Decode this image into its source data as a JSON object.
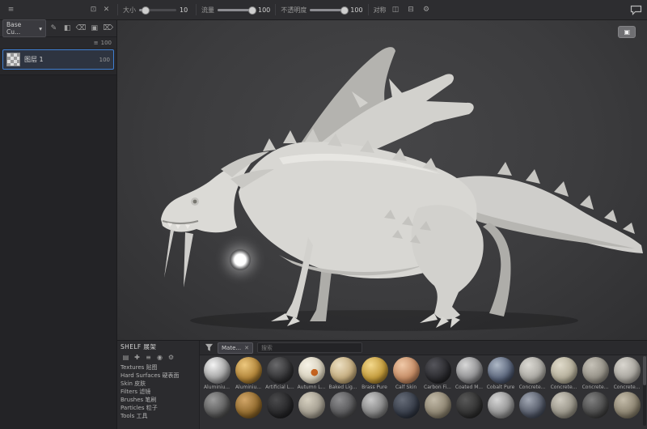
{
  "icons": {
    "menu": "≡",
    "float": "⊡",
    "close": "✕",
    "chevron_down": "▾",
    "pencil": "✎",
    "fill": "◧",
    "eraser": "⌫",
    "stamp": "▣",
    "trash": "⌦",
    "list": "≡",
    "mirror_x": "◫",
    "mirror_y": "⊟",
    "settings": "⚙",
    "folder": "▤",
    "add": "✚",
    "eye": "◉",
    "display": "▣"
  },
  "toolbar": {
    "size_label": "大小",
    "size_value": "10",
    "flow_label": "流量",
    "flow_value": "100",
    "opacity_label": "不透明度",
    "opacity_value": "100",
    "symmetry_label": "对称"
  },
  "left_panel": {
    "preset_label": "Base Cu...",
    "opacity_header": "100",
    "layer": {
      "name": "图层 1",
      "opacity": "100"
    }
  },
  "shelf": {
    "title": "SHELF 展架",
    "tree": [
      {
        "label": "Textures 贴图"
      },
      {
        "label": "Hard Surfaces 硬表面"
      },
      {
        "label": "Skin 皮肤"
      },
      {
        "label": "Filters 滤镜"
      },
      {
        "label": "Brushes 笔刷"
      },
      {
        "label": "Particles 粒子"
      },
      {
        "label": "Tools 工具"
      }
    ],
    "filter_chip": "Mate...",
    "search_placeholder": "搜索",
    "materials": [
      {
        "name": "Aluminiu...",
        "style": "background:radial-gradient(circle at 35% 30%,#f4f4f4,#a8a8a8 50%,#5e5e60 92%)"
      },
      {
        "name": "Aluminiu...",
        "style": "background:radial-gradient(circle at 35% 30%,#edc87e,#b08338 55%,#5f4414 92%)"
      },
      {
        "name": "Artificial L...",
        "style": "background:radial-gradient(circle at 35% 30%,#6a6a6c,#323234 55%,#1b1b1d 92%)"
      },
      {
        "name": "Autumn L...",
        "style": "background:radial-gradient(circle at 60% 58%,#c4631f 0%,#c4631f 15%,rgba(0,0,0,0) 16%),radial-gradient(circle at 35% 30%,#f7f3e7,#d3ccb8 60%,#a59d89 92%)"
      },
      {
        "name": "Baked Lig...",
        "style": "background:radial-gradient(circle at 35% 30%,#ecdfc2,#c3ab7d 55%,#8a744c 92%)"
      },
      {
        "name": "Brass Pure",
        "style": "background:radial-gradient(circle at 35% 30%,#f3d88c,#c29a3a 55%,#72551a 92%)"
      },
      {
        "name": "Calf Skin",
        "style": "background:radial-gradient(circle at 35% 30%,#f0c9a8,#c48b64 55%,#8a5a3c 92%)"
      },
      {
        "name": "Carbon Fi...",
        "style": "background:radial-gradient(circle at 35% 30%,#55555b,#2a2a2e 55%,#151517 92%)"
      },
      {
        "name": "Coated M...",
        "style": "background:radial-gradient(circle at 35% 30%,#d8d8d8,#8e8e90 55%,#505052 92%)"
      },
      {
        "name": "Cobalt Pure",
        "style": "background:radial-gradient(circle at 35% 30%,#aeb8c6,#59647a 55%,#252c3c 92%)"
      },
      {
        "name": "Concrete...",
        "style": "background:radial-gradient(circle at 35% 30%,#dcdad4,#a9a7a1 55%,#75736d 92%)"
      },
      {
        "name": "Concrete...",
        "style": "background:radial-gradient(circle at 35% 30%,#e0dbcb,#b3ad99 55%,#7d7865 92%)"
      },
      {
        "name": "Concrete...",
        "style": "background:radial-gradient(circle at 35% 30%,#c6c2b8,#949086 55%,#64605a 92%)"
      },
      {
        "name": "Concrete...",
        "style": "background:radial-gradient(circle at 35% 30%,#d9d6cf,#a7a49d 55%,#716e68 92%)"
      }
    ],
    "materials_row2": [
      {
        "style": "background:radial-gradient(circle at 35% 30%,#9c9c9c,#565656 60%,#2e2e2e)"
      },
      {
        "style": "background:radial-gradient(circle at 35% 30%,#d2a668,#8a6428 60%,#4a3410)"
      },
      {
        "style": "background:radial-gradient(circle at 35% 30%,#4a4a4c,#242426 60%,#121214)"
      },
      {
        "style": "background:radial-gradient(circle at 35% 30%,#d6d0c0,#9d978a 60%,#6a655a)"
      },
      {
        "style": "background:radial-gradient(circle at 35% 30%,#8e8e90,#535355 60%,#2c2c2e)"
      },
      {
        "style": "background:radial-gradient(circle at 35% 30%,#c9c9c9,#7d7d7d 60%,#484848)"
      },
      {
        "style": "background:radial-gradient(circle at 35% 30%,#666c78,#323844 60%,#181c24)"
      },
      {
        "style": "background:radial-gradient(circle at 35% 30%,#c2baa8,#887f6c 60%,#56503f)"
      },
      {
        "style": "background:radial-gradient(circle at 35% 30%,#585858,#2e2e2e 60%,#161616)"
      },
      {
        "style": "background:radial-gradient(circle at 35% 30%,#d6d6d6,#8c8c8c 60%,#545454)"
      },
      {
        "style": "background:radial-gradient(circle at 35% 30%,#a2a8b4,#4e5462 60%,#242a36)"
      },
      {
        "style": "background:radial-gradient(circle at 35% 30%,#cfcbc0,#928e82 60%,#5e5a50)"
      },
      {
        "style": "background:radial-gradient(circle at 35% 30%,#808080,#434343 60%,#222222)"
      },
      {
        "style": "background:radial-gradient(circle at 35% 30%,#c4bcaa,#857d6a 60%,#524c3c)"
      }
    ]
  }
}
